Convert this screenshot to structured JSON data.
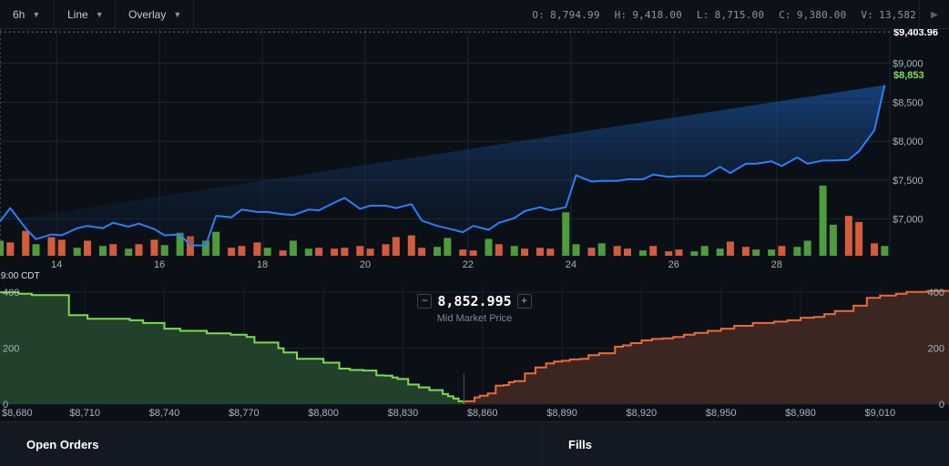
{
  "toolbar": {
    "interval": "6h",
    "chart_type": "Line",
    "overlay": "Overlay",
    "ohlcv": {
      "o_label": "O:",
      "o_val": "8,794.99",
      "h_label": "H:",
      "h_val": "9,418.00",
      "l_label": "L:",
      "l_val": "8,715.00",
      "c_label": "C:",
      "c_val": "9,380.00",
      "v_label": "V:",
      "v_val": "13,582"
    },
    "play_icon": "play-icon"
  },
  "colors": {
    "line": "#2a7fff",
    "up": "#4e9d3c",
    "down": "#d55c3b",
    "bid_line": "#7ddb4e",
    "ask_line": "#ec6a38",
    "current_price": "#7fe05e"
  },
  "chart_data": [
    {
      "type": "line",
      "title": "",
      "x_ticks": [
        "14",
        "16",
        "18",
        "20",
        "22",
        "24",
        "26",
        "28"
      ],
      "y_ticks": [
        "$9,000",
        "$8,500",
        "$8,000",
        "$7,500",
        "$7,000"
      ],
      "y_tick_values": [
        9000,
        8500,
        8000,
        7500,
        7000
      ],
      "ylim": [
        6515,
        9440
      ],
      "xlim": [
        12.9,
        30.2
      ],
      "grid": true,
      "high_marker": {
        "value": 9403.96,
        "label": "$9,403.96"
      },
      "current_price": {
        "value": 8853,
        "label": "$8,853"
      },
      "crosshair_label": "4/29/20, 19:00 CDT",
      "x": [
        12.9,
        13.1,
        13.4,
        13.6,
        13.9,
        14.1,
        14.4,
        14.6,
        14.9,
        15.1,
        15.4,
        15.6,
        15.9,
        16.1,
        16.4,
        16.6,
        16.9,
        17.1,
        17.4,
        17.6,
        17.9,
        18.1,
        18.4,
        18.6,
        18.9,
        19.1,
        19.4,
        19.6,
        19.9,
        20.1,
        20.4,
        20.6,
        20.9,
        21.1,
        21.4,
        21.6,
        21.9,
        22.1,
        22.4,
        22.6,
        22.9,
        23.1,
        23.4,
        23.6,
        23.9,
        24.1,
        24.4,
        24.6,
        24.9,
        25.1,
        25.4,
        25.6,
        25.9,
        26.1,
        26.4,
        26.6,
        26.9,
        27.1,
        27.4,
        27.6,
        27.9,
        28.1,
        28.4,
        28.6,
        28.9,
        29.1,
        29.4,
        29.6,
        29.9,
        30.1
      ],
      "y": [
        6970,
        7140,
        6880,
        6740,
        6800,
        6790,
        6880,
        6910,
        6880,
        6950,
        6900,
        6940,
        6870,
        6790,
        6800,
        6660,
        6660,
        7040,
        7020,
        7120,
        7090,
        7090,
        7060,
        7050,
        7120,
        7110,
        7210,
        7270,
        7130,
        7170,
        7170,
        7140,
        7190,
        6980,
        6910,
        6880,
        6830,
        6910,
        6860,
        6950,
        7010,
        7100,
        7150,
        7110,
        7150,
        7560,
        7480,
        7490,
        7490,
        7510,
        7510,
        7570,
        7540,
        7550,
        7550,
        7550,
        7670,
        7590,
        7710,
        7710,
        7740,
        7680,
        7790,
        7710,
        7750,
        7750,
        7760,
        7870,
        8140,
        8720,
        8760,
        9403.96,
        8860,
        8560,
        8853
      ]
    },
    {
      "type": "bar",
      "title": "",
      "series_meaning": "volume",
      "x": [
        12.9,
        13.1,
        13.4,
        13.6,
        13.9,
        14.1,
        14.4,
        14.6,
        14.9,
        15.1,
        15.4,
        15.6,
        15.9,
        16.1,
        16.4,
        16.6,
        16.9,
        17.1,
        17.4,
        17.6,
        17.9,
        18.1,
        18.4,
        18.6,
        18.9,
        19.1,
        19.4,
        19.6,
        19.9,
        20.1,
        20.4,
        20.6,
        20.9,
        21.1,
        21.4,
        21.6,
        21.9,
        22.1,
        22.4,
        22.6,
        22.9,
        23.1,
        23.4,
        23.6,
        23.9,
        24.1,
        24.4,
        24.6,
        24.9,
        25.1,
        25.4,
        25.6,
        25.9,
        26.1,
        26.4,
        26.6,
        26.9,
        27.1,
        27.4,
        27.6,
        27.9,
        28.1,
        28.4,
        28.6,
        28.9,
        29.1,
        29.4,
        29.6,
        29.9,
        30.1
      ],
      "values": [
        17,
        15,
        28,
        13,
        21,
        18,
        9,
        17,
        11,
        13,
        8,
        13,
        18,
        12,
        26,
        22,
        17,
        27,
        9,
        11,
        15,
        9,
        6,
        17,
        8,
        9,
        8,
        9,
        11,
        8,
        13,
        21,
        23,
        9,
        10,
        20,
        7,
        6,
        19,
        13,
        11,
        8,
        9,
        8,
        49,
        13,
        9,
        14,
        11,
        8,
        6,
        11,
        5,
        7,
        5,
        11,
        8,
        16,
        10,
        7,
        7,
        11,
        10,
        17,
        79,
        35,
        45,
        38,
        14,
        11
      ],
      "direction": [
        "up",
        "down",
        "down",
        "up",
        "down",
        "down",
        "up",
        "down",
        "up",
        "down",
        "up",
        "down",
        "down",
        "up",
        "up",
        "down",
        "up",
        "up",
        "down",
        "down",
        "down",
        "up",
        "down",
        "up",
        "up",
        "down",
        "down",
        "down",
        "down",
        "down",
        "down",
        "down",
        "down",
        "down",
        "up",
        "up",
        "down",
        "down",
        "up",
        "down",
        "up",
        "down",
        "down",
        "down",
        "up",
        "up",
        "down",
        "up",
        "down",
        "down",
        "up",
        "down",
        "down",
        "down",
        "up",
        "up",
        "up",
        "down",
        "down",
        "up",
        "up",
        "down",
        "up",
        "up",
        "up",
        "up",
        "down",
        "down",
        "down",
        "up"
      ]
    },
    {
      "type": "area",
      "title": "",
      "series_meaning": "order-book depth",
      "mid_market_price": "8,852.995",
      "mid_market_label": "Mid Market Price",
      "x_ticks": [
        "$8,680",
        "$8,710",
        "$8,740",
        "$8,770",
        "$8,800",
        "$8,830",
        "$8,860",
        "$8,890",
        "$8,920",
        "$8,950",
        "$8,980",
        "$9,010"
      ],
      "x_tick_values": [
        8680,
        8710,
        8740,
        8770,
        8800,
        8830,
        8860,
        8890,
        8920,
        8950,
        8980,
        9010
      ],
      "y_ticks_left": [
        "400",
        "200",
        "0"
      ],
      "y_ticks_right": [
        "400",
        "200",
        "0"
      ],
      "y_tick_values": [
        400,
        200,
        0
      ],
      "xlim": [
        8678,
        9036
      ],
      "ylim": [
        0,
        420
      ],
      "series": [
        {
          "name": "bids",
          "x": [
            8678,
            8680,
            8685,
            8688,
            8690,
            8704,
            8706,
            8711,
            8713,
            8727,
            8732,
            8736,
            8740,
            8746,
            8750,
            8756,
            8760,
            8765,
            8771,
            8774,
            8777,
            8783,
            8785,
            8790,
            8795,
            8800,
            8805,
            8806,
            8810,
            8815,
            8820,
            8823,
            8826,
            8828,
            8832,
            8836,
            8840,
            8845,
            8847,
            8849,
            8851,
            8853
          ],
          "y": [
            400,
            400,
            395,
            395,
            390,
            318,
            318,
            305,
            305,
            300,
            290,
            290,
            270,
            262,
            262,
            253,
            253,
            248,
            240,
            220,
            220,
            200,
            185,
            162,
            162,
            148,
            148,
            127,
            122,
            120,
            103,
            102,
            95,
            90,
            70,
            60,
            50,
            36,
            28,
            20,
            10,
            0
          ]
        },
        {
          "name": "asks",
          "x": [
            8853,
            8857,
            8859,
            8862,
            8865,
            8868,
            8870,
            8872,
            8876,
            8880,
            8884,
            8887,
            8890,
            8893,
            8897,
            8900,
            8904,
            8910,
            8913,
            8916,
            8920,
            8924,
            8928,
            8932,
            8936,
            8940,
            8945,
            8950,
            8955,
            8962,
            8970,
            8975,
            8980,
            8985,
            8989,
            8993,
            9000,
            9005,
            9010,
            9016,
            9020,
            9028,
            9036
          ],
          "y": [
            0,
            10,
            24,
            30,
            38,
            66,
            68,
            78,
            82,
            110,
            131,
            146,
            152,
            155,
            160,
            162,
            175,
            182,
            205,
            210,
            218,
            228,
            233,
            235,
            240,
            248,
            255,
            262,
            270,
            280,
            290,
            295,
            300,
            309,
            312,
            322,
            333,
            352,
            380,
            388,
            395,
            401,
            405
          ]
        }
      ]
    }
  ],
  "bottom": {
    "left_tab": "Open Orders",
    "right_tab": "Fills"
  }
}
